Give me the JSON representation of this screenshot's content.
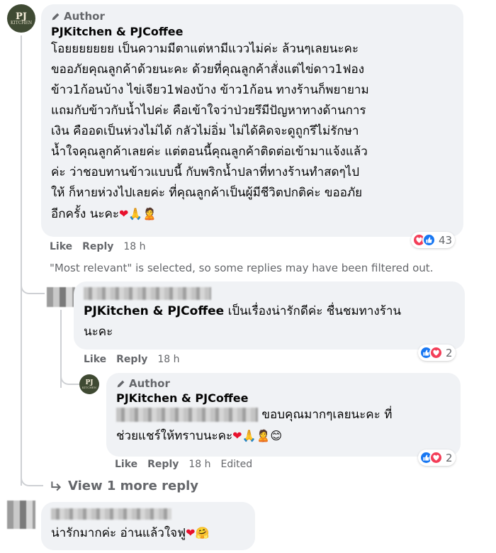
{
  "comment1": {
    "author_label": "Author",
    "name": "PJKitchen & PJCoffee",
    "avatar_text": "PJ",
    "avatar_subtext": "KITCHEN",
    "lines": [
      "โอยยยยยยย เป็นความมีตาแต่หามีแววไม่ค่ะ ล้วนๆเลยนะคะ",
      "ขออภัยคุณลูกค้าด้วยนะคะ ด้วยที่คุณลูกค้าสั่งแต่ไข่ดาว1ฟอง",
      "ข้าว1ก้อนบ้าง ไข่เจียว1ฟองบ้าง ข้าว1ก้อน ทางร้านก็พยายาม",
      "แถมกับข้าวกับน้ำไปค่ะ คือเข้าใจว่าป่วยรึมีปัญหาทางด้านการ",
      "เงิน คืออดเป็นห่วงไม่ได้ กลัวไม่อิ่ม ไม่ได้คิดจะดูถูกรึไม่รักษา",
      "น้ำใจคุณลูกค้าเลยค่ะ แต่ตอนนี้คุณลูกค้าติดต่อเข้ามาแจ้งแล้ว",
      "ค่ะ ว่าชอบทานข้าวแบบนี้ กับพริกน้ำปลาที่ทางร้านทำสดๆไป",
      "ให้ ก็หายห่วงไปเลยค่ะ ที่คุณลูกค้าเป็นผู้มีชีวิตปกติค่ะ ขออภัย",
      "อีกครั้ง นะคะ"
    ],
    "like": "Like",
    "reply": "Reply",
    "time": "18 h",
    "reaction_count": "43"
  },
  "notice": "\"Most relevant\" is selected, so some replies may have been filtered out.",
  "reply1": {
    "name": "PJKitchen & PJCoffee",
    "lines": [
      "เป็นเรื่องน่ารักดีค่ะ ชื่นชมทางร้าน",
      "นะคะ"
    ],
    "like": "Like",
    "reply": "Reply",
    "time": "18 h",
    "reaction_count": "2"
  },
  "reply2": {
    "author_label": "Author",
    "name": "PJKitchen & PJCoffee",
    "line1": "ขอบคุณมากๆเลยนะคะ ที่",
    "line2": "ช่วยแชร์ให้ทราบนะคะ",
    "like": "Like",
    "reply": "Reply",
    "time": "18 h",
    "edited": "Edited",
    "reaction_count": "2"
  },
  "view_more": "View 1 more reply",
  "comment2": {
    "text": "น่ารักมากค่ะ อ่านแล้วใจฟู"
  },
  "emojis": {
    "heart": "❤",
    "pray": "🙏",
    "person": "🙎",
    "smile": "😊",
    "hug": "🤗"
  },
  "colors": {
    "bubble": "#f0f2f5",
    "secondary_text": "#65676b",
    "like_blue": "#1877f2",
    "love_red": "#f33e58"
  }
}
